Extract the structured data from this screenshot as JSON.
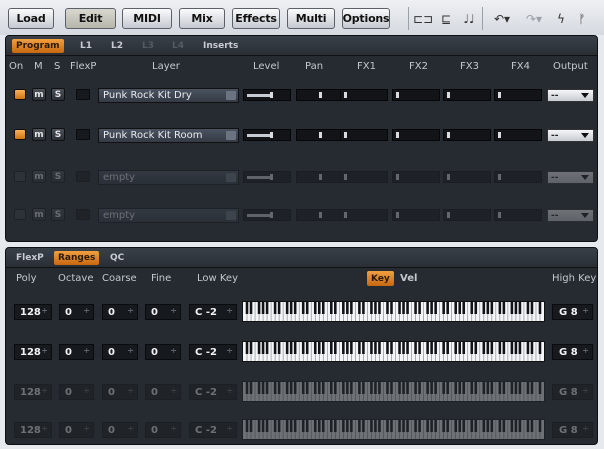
{
  "toolbar": {
    "buttons": [
      "Load",
      "Edit",
      "MIDI",
      "Mix",
      "Effects",
      "Multi",
      "Options"
    ],
    "active": "Edit"
  },
  "layers_panel": {
    "tabs": [
      {
        "label": "Program",
        "state": "active"
      },
      {
        "label": "L1",
        "state": "normal"
      },
      {
        "label": "L2",
        "state": "normal"
      },
      {
        "label": "L3",
        "state": "dim"
      },
      {
        "label": "L4",
        "state": "dim"
      },
      {
        "label": "Inserts",
        "state": "normal"
      }
    ],
    "headers": {
      "on": "On",
      "m": "M",
      "s": "S",
      "flexp": "FlexP",
      "layer": "Layer",
      "level": "Level",
      "pan": "Pan",
      "fx1": "FX1",
      "fx2": "FX2",
      "fx3": "FX3",
      "fx4": "FX4",
      "output": "Output"
    },
    "rows": [
      {
        "layer": "Punk Rock Kit Dry",
        "on": true,
        "m_label": "m",
        "s_label": "S",
        "output": "--",
        "enabled": true
      },
      {
        "layer": "Punk Rock Kit Room",
        "on": true,
        "m_label": "m",
        "s_label": "S",
        "output": "--",
        "enabled": true
      },
      {
        "layer": "empty",
        "on": false,
        "m_label": "m",
        "s_label": "S",
        "output": "--",
        "enabled": false
      },
      {
        "layer": "empty",
        "on": false,
        "m_label": "m",
        "s_label": "S",
        "output": "--",
        "enabled": false
      }
    ]
  },
  "ranges_panel": {
    "tabs": [
      {
        "label": "FlexP",
        "state": "normal"
      },
      {
        "label": "Ranges",
        "state": "active"
      },
      {
        "label": "QC",
        "state": "normal"
      }
    ],
    "headers": {
      "poly": "Poly",
      "octave": "Octave",
      "coarse": "Coarse",
      "fine": "Fine",
      "lowkey": "Low Key",
      "key": "Key",
      "vel": "Vel",
      "highkey": "High Key"
    },
    "rows": [
      {
        "poly": "128",
        "octave": "0",
        "coarse": "0",
        "fine": "0",
        "lowkey": "C -2",
        "highkey": "G 8",
        "enabled": true
      },
      {
        "poly": "128",
        "octave": "0",
        "coarse": "0",
        "fine": "0",
        "lowkey": "C -2",
        "highkey": "G 8",
        "enabled": true
      },
      {
        "poly": "128",
        "octave": "0",
        "coarse": "0",
        "fine": "0",
        "lowkey": "C -2",
        "highkey": "G 8",
        "enabled": false
      },
      {
        "poly": "128",
        "octave": "0",
        "coarse": "0",
        "fine": "0",
        "lowkey": "C -2",
        "highkey": "G 8",
        "enabled": false
      }
    ]
  },
  "colors": {
    "accent": "#e8891f",
    "panel": "#262b31"
  }
}
